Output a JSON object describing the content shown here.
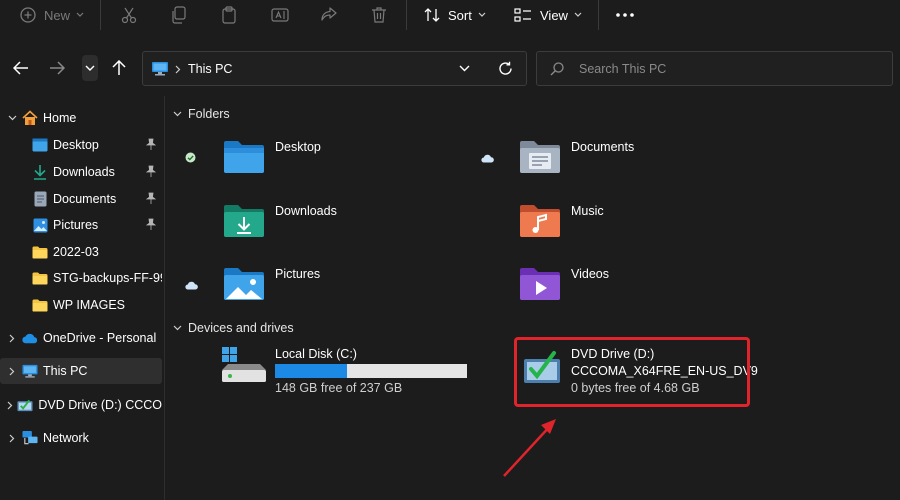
{
  "toolbar": {
    "new_label": "New",
    "sort_label": "Sort",
    "view_label": "View"
  },
  "address": {
    "path": "This PC",
    "search_placeholder": "Search This PC"
  },
  "sidebar": {
    "items": [
      {
        "label": "Home"
      },
      {
        "label": "Desktop"
      },
      {
        "label": "Downloads"
      },
      {
        "label": "Documents"
      },
      {
        "label": "Pictures"
      },
      {
        "label": "2022-03"
      },
      {
        "label": "STG-backups-FF-99..."
      },
      {
        "label": "WP IMAGES"
      },
      {
        "label": "OneDrive - Personal"
      },
      {
        "label": "This PC"
      },
      {
        "label": "DVD Drive (D:) CCCO"
      },
      {
        "label": "Network"
      }
    ]
  },
  "main": {
    "folders_header": "Folders",
    "folders": [
      {
        "name": "Desktop",
        "icon": "desktop-folder-icon",
        "status": "synced"
      },
      {
        "name": "Documents",
        "icon": "documents-folder-icon",
        "status": "cloud"
      },
      {
        "name": "Downloads",
        "icon": "downloads-folder-icon",
        "status": ""
      },
      {
        "name": "Music",
        "icon": "music-folder-icon",
        "status": ""
      },
      {
        "name": "Pictures",
        "icon": "pictures-folder-icon",
        "status": "cloud"
      },
      {
        "name": "Videos",
        "icon": "videos-folder-icon",
        "status": ""
      }
    ],
    "drives_header": "Devices and drives",
    "drives": [
      {
        "name": "Local Disk (C:)",
        "free_text": "148 GB free of 237 GB",
        "used_fraction": 0.3755
      },
      {
        "name": "DVD Drive (D:)",
        "label": "CCCOMA_X64FRE_EN-US_DV9",
        "free_text": "0 bytes free of 4.68 GB"
      }
    ]
  },
  "colors": {
    "accent": "#1c8ae4",
    "highlight": "#e0242b"
  }
}
